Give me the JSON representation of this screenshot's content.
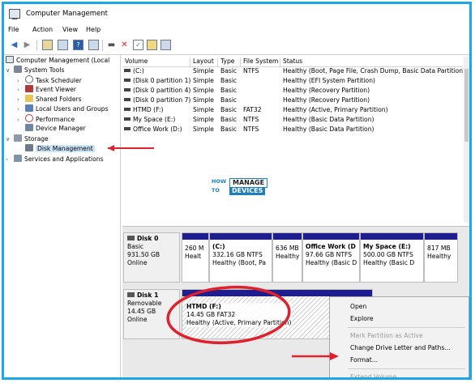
{
  "window": {
    "title": "Computer Management"
  },
  "menubar": [
    "File",
    "Action",
    "View",
    "Help"
  ],
  "toolbar": {
    "icons": [
      "back-icon",
      "forward-icon",
      "up-icon",
      "console-tree-icon",
      "help-icon",
      "properties-icon",
      "connect-icon",
      "delete-icon",
      "check-icon",
      "rescan-icon",
      "refresh-icon"
    ]
  },
  "tree": {
    "root": "Computer Management (Local",
    "system_tools": "System Tools",
    "task_scheduler": "Task Scheduler",
    "event_viewer": "Event Viewer",
    "shared_folders": "Shared Folders",
    "local_users": "Local Users and Groups",
    "performance": "Performance",
    "device_manager": "Device Manager",
    "storage": "Storage",
    "disk_management": "Disk Management",
    "services": "Services and Applications"
  },
  "volume_list": {
    "columns": [
      "Volume",
      "Layout",
      "Type",
      "File System",
      "Status"
    ],
    "rows": [
      [
        "(C:)",
        "Simple",
        "Basic",
        "NTFS",
        "Healthy (Boot, Page File, Crash Dump, Basic Data Partition)"
      ],
      [
        "(Disk 0 partition 1)",
        "Simple",
        "Basic",
        "",
        "Healthy (EFI System Partition)"
      ],
      [
        "(Disk 0 partition 4)",
        "Simple",
        "Basic",
        "",
        "Healthy (Recovery Partition)"
      ],
      [
        "(Disk 0 partition 7)",
        "Simple",
        "Basic",
        "",
        "Healthy (Recovery Partition)"
      ],
      [
        "HTMD (F:)",
        "Simple",
        "Basic",
        "FAT32",
        "Healthy (Active, Primary Partition)"
      ],
      [
        "My Space (E:)",
        "Simple",
        "Basic",
        "NTFS",
        "Healthy (Basic Data Partition)"
      ],
      [
        "Office Work (D:)",
        "Simple",
        "Basic",
        "NTFS",
        "Healthy (Basic Data Partition)"
      ]
    ]
  },
  "logo": {
    "how": "HOW",
    "to": "TO",
    "manage": "MANAGE",
    "devices": "DEVICES"
  },
  "disks": {
    "disk0": {
      "name": "Disk 0",
      "type": "Basic",
      "size": "931.50 GB",
      "status": "Online",
      "partitions": [
        {
          "line1": "260 M",
          "line2": "Healt"
        },
        {
          "title": "(C:)",
          "line1": "332.16 GB NTFS",
          "line2": "Healthy (Boot, Pa"
        },
        {
          "line1": "636 MB",
          "line2": "Healthy"
        },
        {
          "title": "Office Work  (D",
          "line1": "97.66 GB NTFS",
          "line2": "Healthy (Basic D"
        },
        {
          "title": "My Space  (E:)",
          "line1": "500.00 GB NTFS",
          "line2": "Healthy (Basic D"
        },
        {
          "line1": "817 MB",
          "line2": "Healthy"
        }
      ]
    },
    "disk1": {
      "name": "Disk 1",
      "type": "Removable",
      "size": "14.45 GB",
      "status": "Online",
      "partition": {
        "title": "HTMD  (F:)",
        "line1": "14.45 GB FAT32",
        "line2": "Healthy (Active, Primary Partition)"
      }
    }
  },
  "context_menu": {
    "open": "Open",
    "explore": "Explore",
    "mark_active": "Mark Partition as Active",
    "change_letter": "Change Drive Letter and Paths...",
    "format": "Format...",
    "extend": "Extend Volume..."
  },
  "colors": {
    "accent_border": "#1ea7e8",
    "annotation_red": "#e0202a",
    "partition_bar": "#1e1e8f"
  }
}
